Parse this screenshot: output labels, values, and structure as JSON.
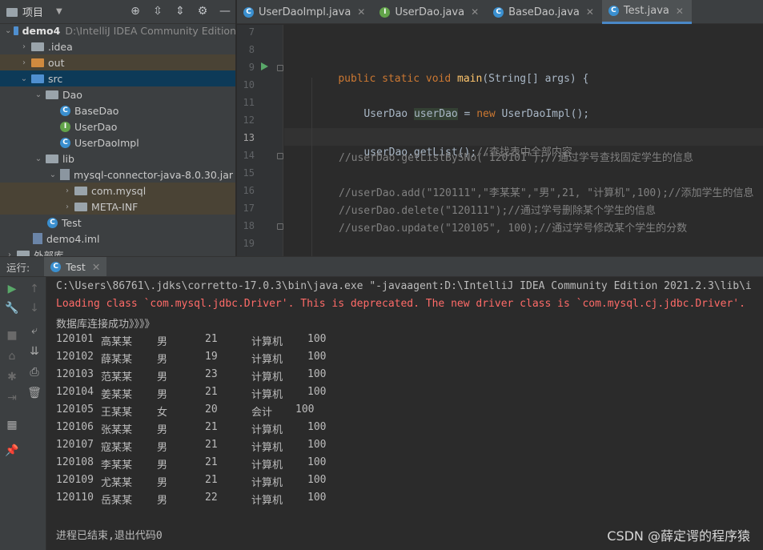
{
  "project": {
    "title": "项目",
    "tree": [
      {
        "label": "demo4",
        "path": "D:\\IntelliJ IDEA Community Edition"
      },
      {
        "label": ".idea"
      },
      {
        "label": "out"
      },
      {
        "label": "src"
      },
      {
        "label": "Dao"
      },
      {
        "label": "BaseDao"
      },
      {
        "label": "UserDao"
      },
      {
        "label": "UserDaoImpl"
      },
      {
        "label": "lib"
      },
      {
        "label": "mysql-connector-java-8.0.30.jar"
      },
      {
        "label": "com.mysql"
      },
      {
        "label": "META-INF"
      },
      {
        "label": "Test"
      },
      {
        "label": "demo4.iml"
      },
      {
        "label": "外部库"
      }
    ]
  },
  "tabs": [
    {
      "label": "UserDaoImpl.java",
      "icon": "C"
    },
    {
      "label": "UserDao.java",
      "icon": "I"
    },
    {
      "label": "BaseDao.java",
      "icon": "C"
    },
    {
      "label": "Test.java",
      "icon": "C"
    }
  ],
  "editor": {
    "line_numbers": [
      "7",
      "8",
      "9",
      "10",
      "11",
      "12",
      "13",
      "14",
      "15",
      "16",
      "17",
      "18",
      "19"
    ],
    "current_line": "13",
    "code": {
      "l9_kw": "public static void ",
      "l9_fn": "main",
      "l9_rest": "(String[] args) {",
      "l11_type": "UserDao ",
      "l11_var": "userDao",
      "l11_eq": " = ",
      "l11_new": "new ",
      "l11_ctor": "UserDaoImpl();",
      "l13_call": "userDao.getList();",
      "l13_cm": "//查找表中全部内容",
      "l14": "//userDao.getListBySNo(\"120101\");//通过学号查找固定学生的信息",
      "l16": "//userDao.add(\"120111\",\"李某某\",\"男\",21, \"计算机\",100);//添加学生的信息",
      "l17": "//userDao.delete(\"120111\");//通过学号删除某个学生的信息",
      "l18": "//userDao.update(\"120105\", 100);//通过学号修改某个学生的分数"
    }
  },
  "run": {
    "label": "运行:",
    "tab": "Test",
    "cmd": "C:\\Users\\86761\\.jdks\\corretto-17.0.3\\bin\\java.exe \"-javaagent:D:\\IntelliJ IDEA Community Edition 2021.2.3\\lib\\i",
    "warn": "Loading class `com.mysql.jdbc.Driver'. This is deprecated. The new driver class is `com.mysql.cj.jdbc.Driver'.",
    "connected": "数据库连接成功》》》》",
    "rows": [
      [
        "120101",
        "高某某",
        "男",
        "21",
        "计算机",
        "100"
      ],
      [
        "120102",
        "薛某某",
        "男",
        "19",
        "计算机",
        "100"
      ],
      [
        "120103",
        "范某某",
        "男",
        "23",
        "计算机",
        "100"
      ],
      [
        "120104",
        "姜某某",
        "男",
        "21",
        "计算机",
        "100"
      ],
      [
        "120105",
        "王某某",
        "女",
        "20",
        "会计",
        "100"
      ],
      [
        "120106",
        "张某某",
        "男",
        "21",
        "计算机",
        "100"
      ],
      [
        "120107",
        "寇某某",
        "男",
        "21",
        "计算机",
        "100"
      ],
      [
        "120108",
        "李某某",
        "男",
        "21",
        "计算机",
        "100"
      ],
      [
        "120109",
        "尤某某",
        "男",
        "21",
        "计算机",
        "100"
      ],
      [
        "120110",
        "岳某某",
        "男",
        "22",
        "计算机",
        "100"
      ]
    ],
    "exit": "进程已结束,退出代码0"
  },
  "watermark": "CSDN @薛定谔的程序猿",
  "colors": {
    "accent": "#4a88c7",
    "error": "#ff6b68",
    "run": "#59a869"
  }
}
